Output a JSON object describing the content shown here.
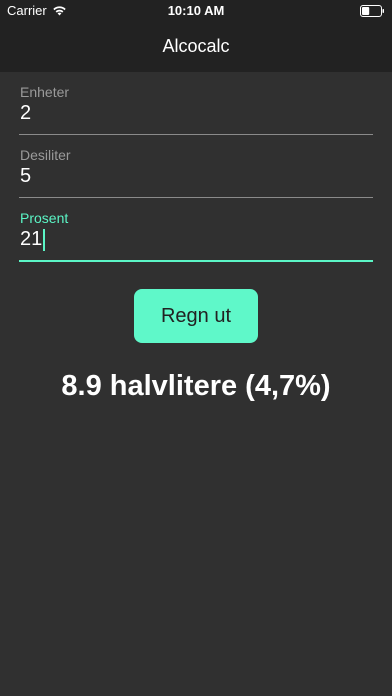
{
  "status_bar": {
    "carrier": "Carrier",
    "time": "10:10 AM",
    "wifi_icon": "wifi-icon",
    "battery_icon": "battery-icon",
    "battery_level": 0.4
  },
  "nav": {
    "title": "Alcocalc"
  },
  "form": {
    "units": {
      "label": "Enheter",
      "value": "2"
    },
    "deciliters": {
      "label": "Desiliter",
      "value": "5"
    },
    "percent": {
      "label": "Prosent",
      "value": "21"
    }
  },
  "button": {
    "label": "Regn ut"
  },
  "result": {
    "text": "8.9 halvlitere (4,7%)"
  },
  "colors": {
    "accent": "#5bf6c6",
    "background": "#303030",
    "header": "#222222"
  }
}
